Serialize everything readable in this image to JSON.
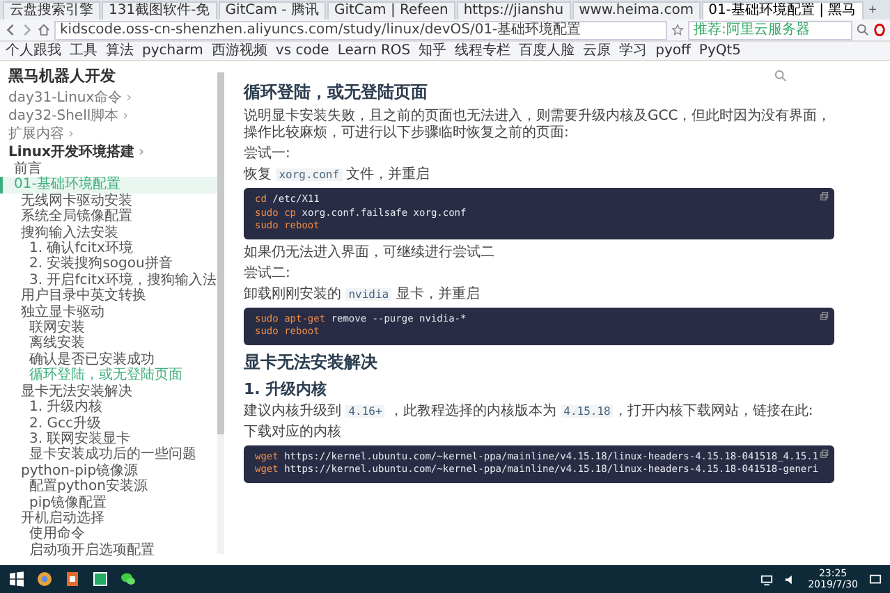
{
  "browser": {
    "tabs": [
      {
        "title": "云盘搜索引擎",
        "selected": false
      },
      {
        "title": "131截图软件-免",
        "selected": false
      },
      {
        "title": "GitCam - 腾讯",
        "selected": false
      },
      {
        "title": "GitCam | Refeen",
        "selected": false
      },
      {
        "title": "https://jianshu",
        "selected": false
      },
      {
        "title": "www.heima.com",
        "selected": false
      },
      {
        "title": "01-基础环境配置 | 黑马",
        "selected": true
      }
    ],
    "new_tab": "+",
    "address": "kidscode.oss-cn-shenzhen.aliyuncs.com/study/linux/devOS/01-基础环境配置",
    "search_placeholder": "推荐:阿里云服务器",
    "bookmarks": [
      "个人跟我",
      "工具",
      "算法",
      "pycharm",
      "西游视频",
      "vs code",
      "Learn ROS",
      "知乎",
      "线程专栏",
      "百度人脸",
      "云原",
      "学习",
      "pyoff",
      "PyQt5"
    ]
  },
  "site_title": "黑马机器人开发",
  "sidebar": [
    {
      "label": "day31-Linux命令",
      "arrow": "›",
      "selected": false,
      "current": false
    },
    {
      "label": "day32-Shell脚本",
      "arrow": "›",
      "selected": false,
      "current": false
    },
    {
      "label": "扩展内容",
      "arrow": "›",
      "selected": false,
      "current": false
    },
    {
      "label": "Linux开发环境搭建",
      "arrow": "›",
      "selected": false,
      "current": false,
      "children": [
        {
          "label": "前言",
          "selected": false,
          "current": false
        },
        {
          "label": "01-基础环境配置",
          "selected": true,
          "current": false,
          "children": [
            {
              "label": "无线网卡驱动安装",
              "selected": false,
              "current": false
            },
            {
              "label": "系统全局镜像配置",
              "selected": false,
              "current": false
            },
            {
              "label": "搜狗输入法安装",
              "selected": false,
              "current": false,
              "children": [
                {
                  "label": "1. 确认fcitx环境",
                  "selected": false,
                  "current": false
                },
                {
                  "label": "2. 安装搜狗sogou拼音",
                  "selected": false,
                  "current": false
                },
                {
                  "label": "3. 开启fcitx环境，搜狗输入法",
                  "selected": false,
                  "current": false
                }
              ]
            },
            {
              "label": "用户目录中英文转换",
              "selected": false,
              "current": false
            },
            {
              "label": "独立显卡驱动",
              "selected": false,
              "current": false,
              "children": [
                {
                  "label": "联网安装",
                  "selected": false,
                  "current": false
                },
                {
                  "label": "离线安装",
                  "selected": false,
                  "current": false
                },
                {
                  "label": "确认是否已安装成功",
                  "selected": false,
                  "current": false
                },
                {
                  "label": "循环登陆，或无登陆页面",
                  "selected": false,
                  "current": true
                }
              ]
            },
            {
              "label": "显卡无法安装解决",
              "selected": false,
              "current": false,
              "children": [
                {
                  "label": "1. 升级内核",
                  "selected": false,
                  "current": false
                },
                {
                  "label": "2. Gcc升级",
                  "selected": false,
                  "current": false
                },
                {
                  "label": "3. 联网安装显卡",
                  "selected": false,
                  "current": false
                },
                {
                  "label": "显卡安装成功后的一些问题",
                  "selected": false,
                  "current": false
                }
              ]
            },
            {
              "label": "python-pip镜像源",
              "selected": false,
              "current": false,
              "children": [
                {
                  "label": "配置python安装源",
                  "selected": false,
                  "current": false
                },
                {
                  "label": "pip镜像配置",
                  "selected": false,
                  "current": false
                }
              ]
            },
            {
              "label": "开机启动选择",
              "selected": false,
              "current": false,
              "children": [
                {
                  "label": "使用命令",
                  "selected": false,
                  "current": false
                },
                {
                  "label": "启动项开启选项配置",
                  "selected": false,
                  "current": false
                }
              ]
            }
          ]
        }
      ]
    }
  ],
  "content": [
    {
      "kind": "h2",
      "text": "循环登陆，或无登陆页面"
    },
    {
      "kind": "p",
      "parts": [
        {
          "kind": "text",
          "text": "说明显卡安装失败，且之前的页面也无法进入，则需要升级内核及GCC，但此时因为没有界面，操作比较麻烦，可进行以下步骤临时恢复之前的页面:"
        }
      ]
    },
    {
      "kind": "p",
      "parts": [
        {
          "kind": "text",
          "text": "尝试一:"
        }
      ]
    },
    {
      "kind": "p",
      "parts": [
        {
          "kind": "text",
          "text": "恢复 "
        },
        {
          "kind": "code",
          "text": "xorg.conf"
        },
        {
          "kind": "text",
          "text": " 文件，并重启"
        }
      ]
    },
    {
      "kind": "code",
      "lines": [
        {
          "cmd": "cd",
          "rest": "/etc/X11"
        },
        {
          "cmd": "sudo cp",
          "rest": "xorg.conf.failsafe xorg.conf"
        },
        {
          "cmd": "sudo reboot"
        }
      ]
    },
    {
      "kind": "p",
      "parts": [
        {
          "kind": "text",
          "text": "如果仍无法进入界面，可继续进行尝试二"
        }
      ]
    },
    {
      "kind": "p",
      "parts": [
        {
          "kind": "text",
          "text": "尝试二:"
        }
      ]
    },
    {
      "kind": "p",
      "parts": [
        {
          "kind": "text",
          "text": "卸载刚刚安装的 "
        },
        {
          "kind": "code",
          "text": "nvidia"
        },
        {
          "kind": "text",
          "text": " 显卡，并重启"
        }
      ]
    },
    {
      "kind": "code",
      "lines": [
        {
          "cmd": "sudo apt-get",
          "rest": "remove --purge nvidia-*"
        },
        {
          "cmd": "sudo reboot"
        }
      ]
    },
    {
      "kind": "h2",
      "text": "显卡无法安装解决"
    },
    {
      "kind": "h3",
      "text": "1. 升级内核"
    },
    {
      "kind": "p",
      "parts": [
        {
          "kind": "text",
          "text": "建议内核升级到 "
        },
        {
          "kind": "code",
          "text": "4.16+"
        },
        {
          "kind": "text",
          "text": " ，此教程选择的内核版本为 "
        },
        {
          "kind": "code",
          "text": "4.15.18"
        },
        {
          "kind": "text",
          "text": "，打开内核下载网站，链接在此:"
        }
      ]
    },
    {
      "kind": "p",
      "parts": [
        {
          "kind": "text",
          "text": "下载对应的内核"
        }
      ]
    },
    {
      "kind": "code",
      "lines": [
        {
          "cmd": "wget",
          "rest": "https://kernel.ubuntu.com/~kernel-ppa/mainline/v4.15.18/linux-headers-4.15.18-041518_4.15.1"
        },
        {
          "cmd": "wget",
          "rest": "https://kernel.ubuntu.com/~kernel-ppa/mainline/v4.15.18/linux-headers-4.15.18-041518-generi"
        }
      ]
    }
  ],
  "taskbar": {
    "time": "23:25",
    "date": "2019/7/30"
  }
}
